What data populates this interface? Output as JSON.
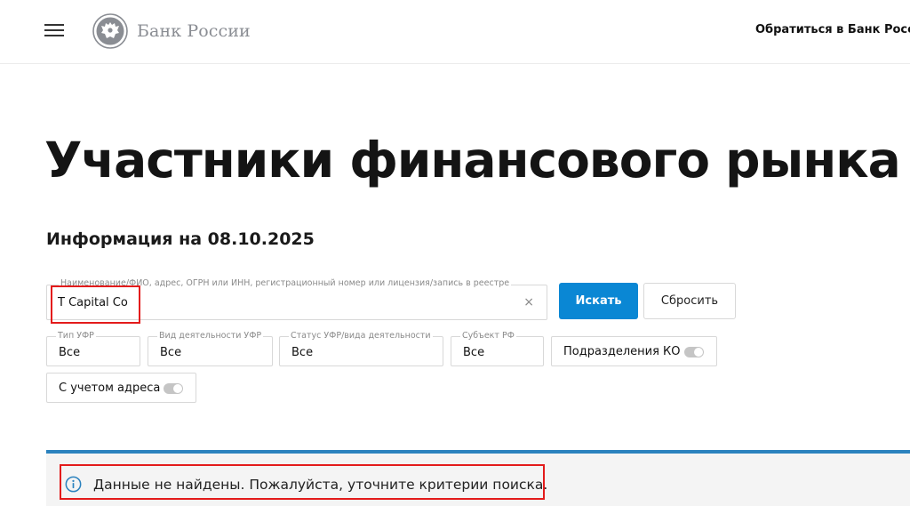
{
  "header": {
    "logo_text": "Банк России",
    "contact_link": "Обратиться в Банк России"
  },
  "page": {
    "title": "Участники финансового рынка",
    "info_date": "Информация на 08.10.2025"
  },
  "search": {
    "label": "Наименование/ФИО, адрес, ОГРН или ИНН, регистрационный номер или лицензия/запись в реестре",
    "value": "T Capital Co",
    "clear_glyph": "×",
    "search_button": "Искать",
    "reset_button": "Сбросить"
  },
  "filters": {
    "ufr_type": {
      "label": "Тип УФР",
      "value": "Все"
    },
    "activity": {
      "label": "Вид деятельности УФР",
      "value": "Все"
    },
    "status": {
      "label": "Статус УФР/вида деятельности",
      "value": "Все"
    },
    "region": {
      "label": "Субъект РФ",
      "value": "Все"
    },
    "ko_divisions": {
      "label": "Подразделения КО",
      "enabled": false
    },
    "with_address": {
      "label": "С учетом адреса",
      "enabled": false
    }
  },
  "notice": {
    "text": "Данные не найдены. Пожалуйста, уточните критерии поиска.",
    "color": "#2b82be"
  },
  "colors": {
    "primary_button": "#0a87d4",
    "highlight": "#e31b1b"
  }
}
